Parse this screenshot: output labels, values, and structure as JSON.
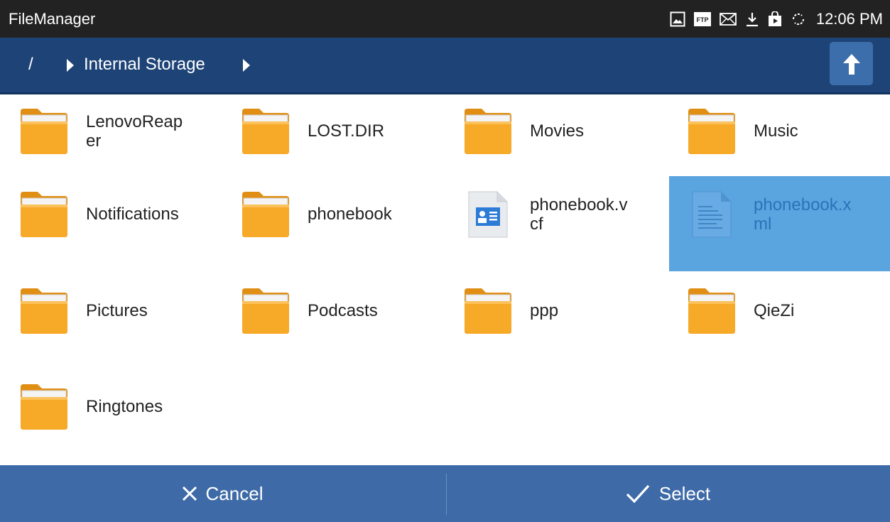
{
  "statusbar": {
    "app_title": "FileManager",
    "icons": [
      "image-icon",
      "ftp-icon",
      "mail-icon",
      "download-icon",
      "store-icon",
      "sync-icon"
    ],
    "ftp_text": "FTP",
    "time": "12:06 PM"
  },
  "pathbar": {
    "root": "/",
    "current": "Internal Storage",
    "up_icon": "up-arrow-icon"
  },
  "files": [
    {
      "name": "LenovoReap\ner",
      "type": "folder"
    },
    {
      "name": "LOST.DIR",
      "type": "folder"
    },
    {
      "name": "Movies",
      "type": "folder"
    },
    {
      "name": "Music",
      "type": "folder"
    },
    {
      "name": "Notifications",
      "type": "folder"
    },
    {
      "name": "phonebook",
      "type": "folder"
    },
    {
      "name": "phonebook.v\ncf",
      "type": "vcf"
    },
    {
      "name": "phonebook.x\nml",
      "type": "xml",
      "selected": true
    },
    {
      "name": "Pictures",
      "type": "folder"
    },
    {
      "name": "Podcasts",
      "type": "folder"
    },
    {
      "name": "ppp",
      "type": "folder"
    },
    {
      "name": "QieZi",
      "type": "folder"
    },
    {
      "name": "Ringtones",
      "type": "folder"
    }
  ],
  "actions": {
    "cancel_label": "Cancel",
    "select_label": "Select"
  },
  "colors": {
    "statusbar": "#222222",
    "pathbar": "#1e4377",
    "actionbar": "#3e6ba8",
    "selected": "#5aa4e0",
    "folder": "#f5a623"
  }
}
